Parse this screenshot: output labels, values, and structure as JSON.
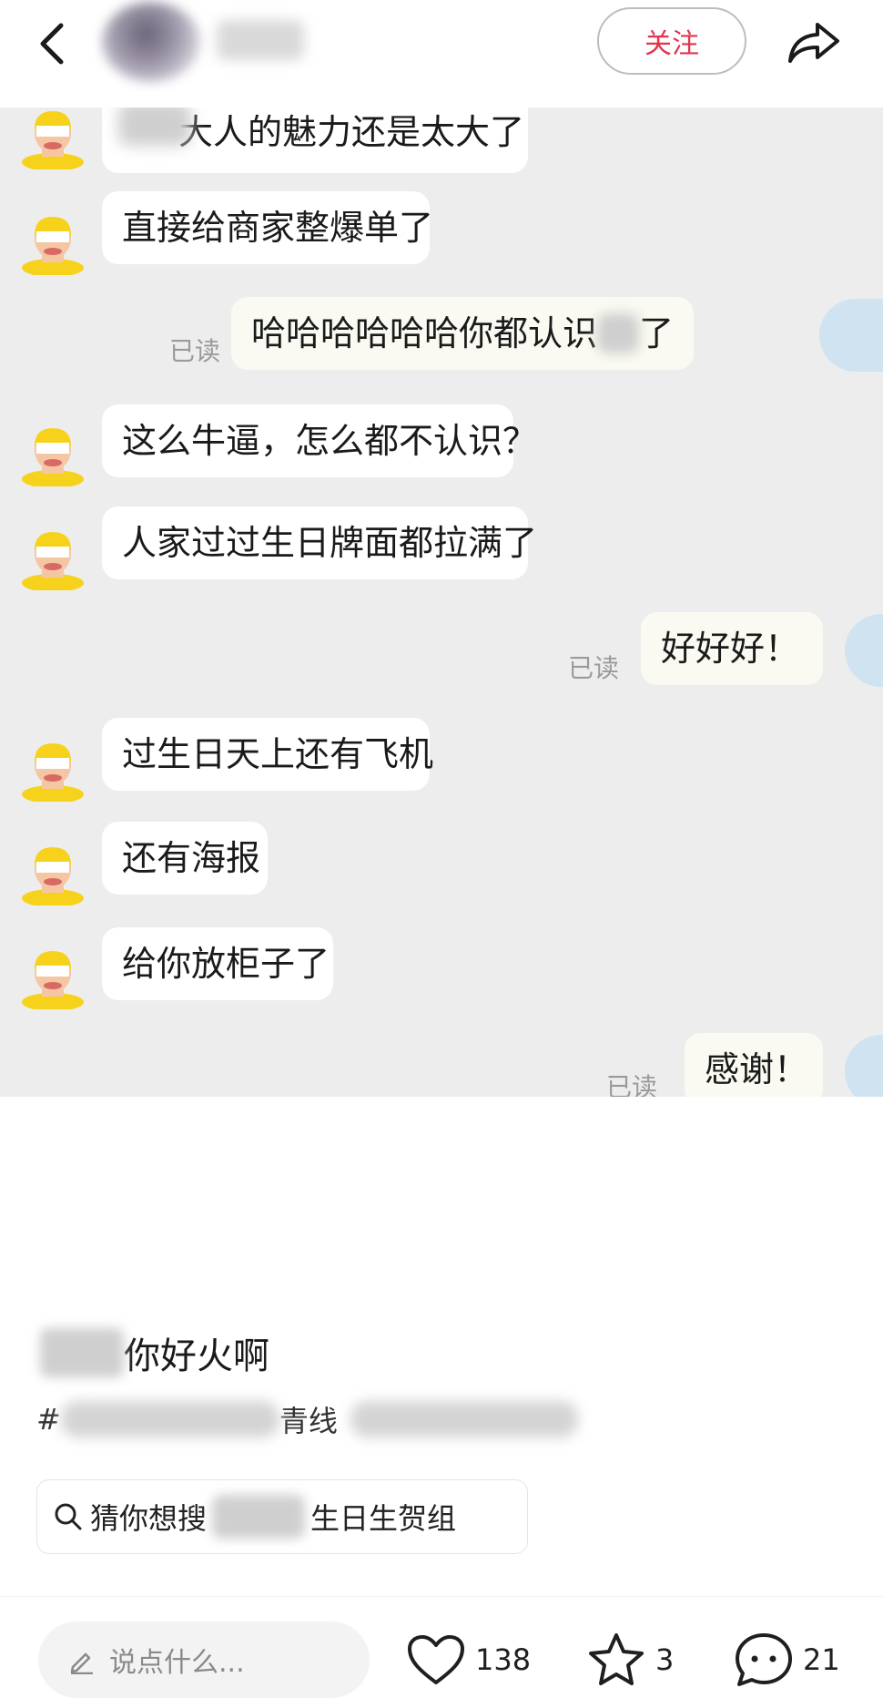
{
  "header": {
    "follow_label": "关注",
    "icons": {
      "back": "chevron-left-icon",
      "share": "share-arrow-icon"
    }
  },
  "chat": {
    "messages": [
      {
        "side": "left",
        "text": "大人的魅力还是太大了"
      },
      {
        "side": "left",
        "text": "直接给商家整爆单了"
      },
      {
        "side": "right",
        "text_a": "哈哈哈哈哈哈你都认识",
        "text_b": "了",
        "read": "已读"
      },
      {
        "side": "left",
        "text": "这么牛逼，怎么都不认识？"
      },
      {
        "side": "left",
        "text": "人家过过生日牌面都拉满了"
      },
      {
        "side": "right",
        "text": "好好好！",
        "read": "已读"
      },
      {
        "side": "left",
        "text": "过生日天上还有飞机"
      },
      {
        "side": "left",
        "text": "还有海报"
      },
      {
        "side": "left",
        "text": "给你放柜子了"
      },
      {
        "side": "right",
        "text": "感谢！",
        "read": "已读"
      }
    ]
  },
  "post": {
    "title": "你好火啊",
    "hashtags": {
      "prefix": "#",
      "visible_fragment": "青线"
    },
    "suggest": {
      "prefix": "猜你想搜",
      "suffix": "生日生贺组"
    }
  },
  "bottom_bar": {
    "comment_placeholder": "说点什么...",
    "likes": "138",
    "favorites": "3",
    "comments": "21"
  },
  "colors": {
    "accent": "#e2344e",
    "chat_bg": "#ededed",
    "avatar_yellow": "#f7d21c",
    "self_avatar": "#cfe3f1"
  }
}
